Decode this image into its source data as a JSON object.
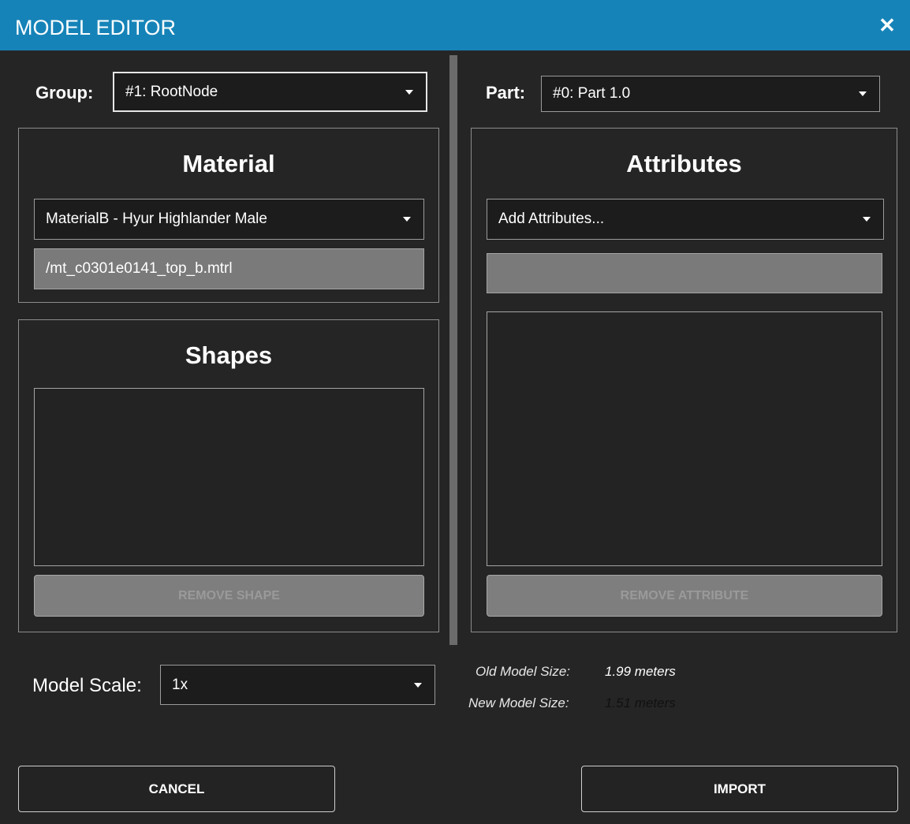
{
  "window": {
    "title": "MODEL EDITOR",
    "close_glyph": "✕"
  },
  "left": {
    "group_label": "Group:",
    "group_value": "#1: RootNode",
    "material": {
      "title": "Material",
      "selected": "MaterialB - Hyur Highlander Male",
      "path": "/mt_c0301e0141_top_b.mtrl"
    },
    "shapes": {
      "title": "Shapes",
      "remove_label": "REMOVE SHAPE"
    }
  },
  "right": {
    "part_label": "Part:",
    "part_value": "#0: Part 1.0",
    "attributes": {
      "title": "Attributes",
      "selected": "Add Attributes...",
      "input_value": "",
      "remove_label": "REMOVE ATTRIBUTE"
    }
  },
  "scale": {
    "label": "Model Scale:",
    "value": "1x"
  },
  "size_info": {
    "old_label": "Old Model Size:",
    "old_value": "1.99 meters",
    "new_label": "New Model Size:",
    "new_value": "1.51 meters"
  },
  "footer": {
    "cancel_label": "CANCEL",
    "import_label": "IMPORT"
  },
  "colors": {
    "titlebar": "#1683b8",
    "background": "#252526",
    "new_size_value": "#111111"
  }
}
